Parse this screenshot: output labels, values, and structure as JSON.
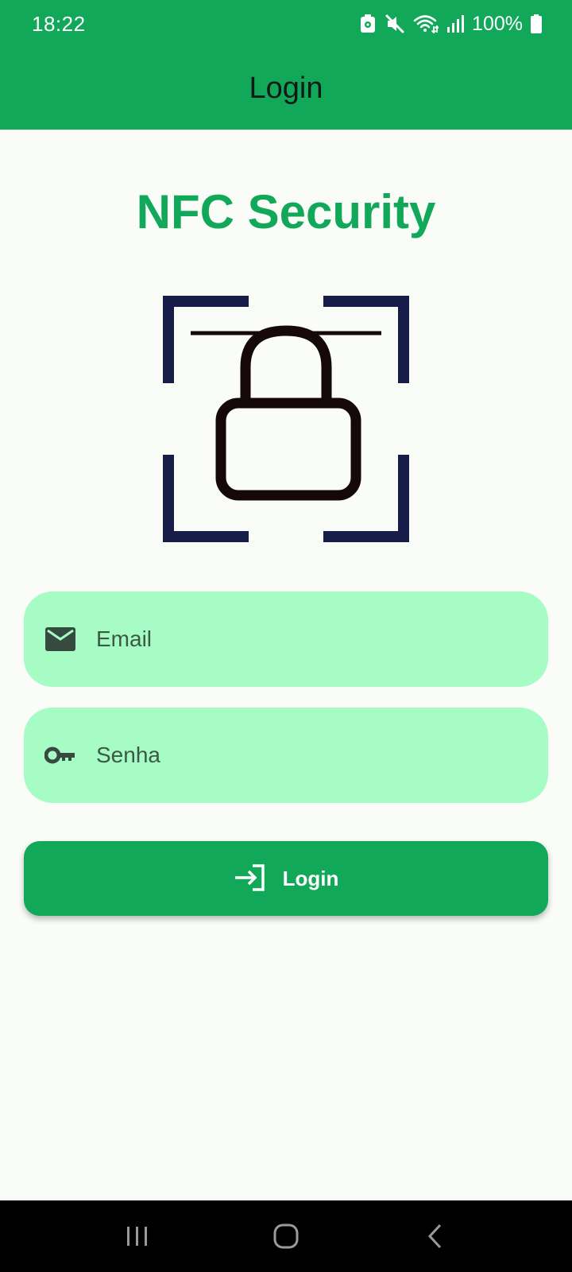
{
  "status_bar": {
    "time": "18:22",
    "battery": "100%",
    "icons": [
      "vault-icon",
      "mute-icon",
      "wifi-icon",
      "signal-icon",
      "battery-icon"
    ]
  },
  "app_bar": {
    "title": "Login"
  },
  "content": {
    "app_title": "NFC Security",
    "illustration": "nfc-lock-scan-icon",
    "email": {
      "placeholder": "Email",
      "value": "",
      "icon": "email-icon"
    },
    "password": {
      "placeholder": "Senha",
      "value": "",
      "icon": "key-icon"
    },
    "login_button": {
      "label": "Login",
      "icon": "login-icon"
    }
  },
  "nav_bar": {
    "buttons": [
      "recents-button",
      "home-button",
      "back-button"
    ]
  },
  "colors": {
    "primary": "#12a85a",
    "field_background": "#a7fbc5",
    "background": "#fafcf8",
    "frame": "#161d48",
    "lock": "#140808"
  }
}
